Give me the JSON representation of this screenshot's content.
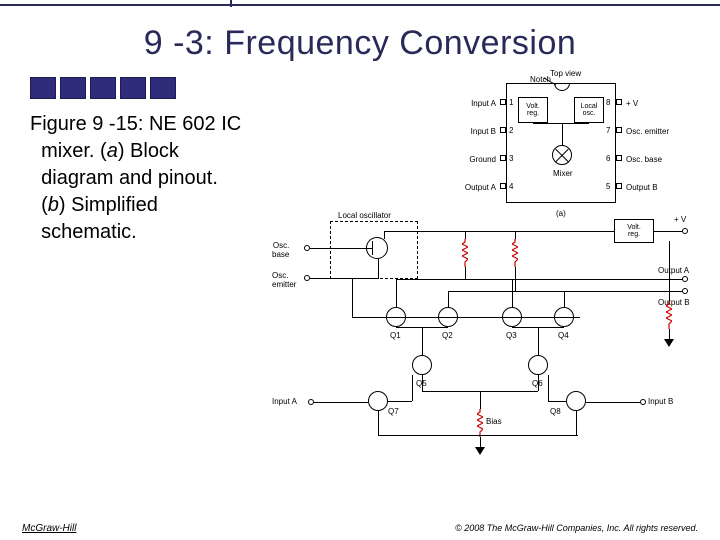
{
  "title": "9 -3: Frequency Conversion",
  "caption": {
    "line1": "Figure 9 -15: NE 602 IC",
    "line2": "mixer. (",
    "line2_em": "a",
    "line2b": ") Block",
    "line3": "diagram and pinout.",
    "line4": "(",
    "line4_em": "b",
    "line4b": ") Simplified",
    "line5": "schematic."
  },
  "figA": {
    "top": "Top view",
    "notch": "Notch",
    "volt_reg": "Volt.\nreg.",
    "local_osc": "Local\nosc.",
    "mixer": "Mixer",
    "pins_left": [
      "Input A",
      "Input B",
      "Ground",
      "Output A"
    ],
    "pins_right": [
      "+ V",
      "Osc. emitter",
      "Osc. base",
      "Output B"
    ],
    "nums_left": [
      "1",
      "2",
      "3",
      "4"
    ],
    "nums_right": [
      "8",
      "7",
      "6",
      "5"
    ],
    "sub": "(a)"
  },
  "figB": {
    "local_osc": "Local oscillator",
    "osc_base": "Osc.\nbase",
    "osc_emitter": "Osc.\nemitter",
    "volt_reg": "Volt.\nreg.",
    "vplus": "+ V",
    "output_a": "Output A",
    "output_b": "Output B",
    "input_a": "Input A",
    "input_b": "Input B",
    "q": [
      "Q1",
      "Q2",
      "Q3",
      "Q4",
      "Q5",
      "Q6",
      "Q7",
      "Q8"
    ],
    "bias": "Bias"
  },
  "footer": {
    "left": "McGraw-Hill",
    "right": "© 2008 The McGraw-Hill Companies, Inc. All rights reserved."
  }
}
